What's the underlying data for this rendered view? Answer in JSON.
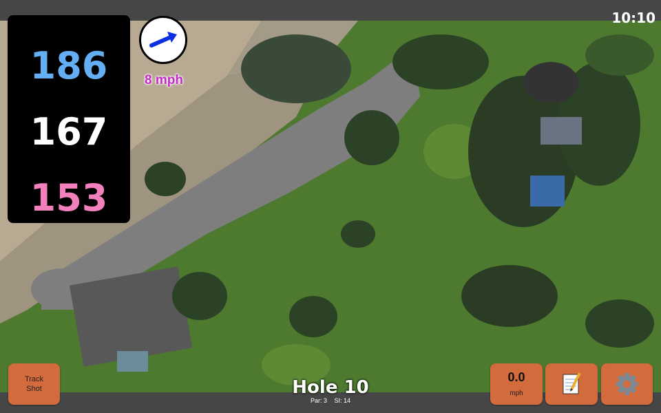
{
  "status": {
    "time": "10:10"
  },
  "distances": {
    "back": "186",
    "center": "167",
    "front": "153"
  },
  "wind": {
    "speed_label": "8 mph",
    "icon": "wind-arrow-icon"
  },
  "hole": {
    "title": "Hole 10",
    "par_label": "Par: 3",
    "si_label": "SI: 14"
  },
  "buttons": {
    "track_shot": "Track Shot",
    "speed_value": "0.0",
    "speed_unit": "mph",
    "notes_icon": "notepad-icon",
    "settings_icon": "gear-icon"
  },
  "colors": {
    "back_distance": "#64aef4",
    "center_distance": "#ffffff",
    "front_distance": "#f37fbd",
    "wind_label": "#c42bc4",
    "button": "#d46b3d"
  }
}
